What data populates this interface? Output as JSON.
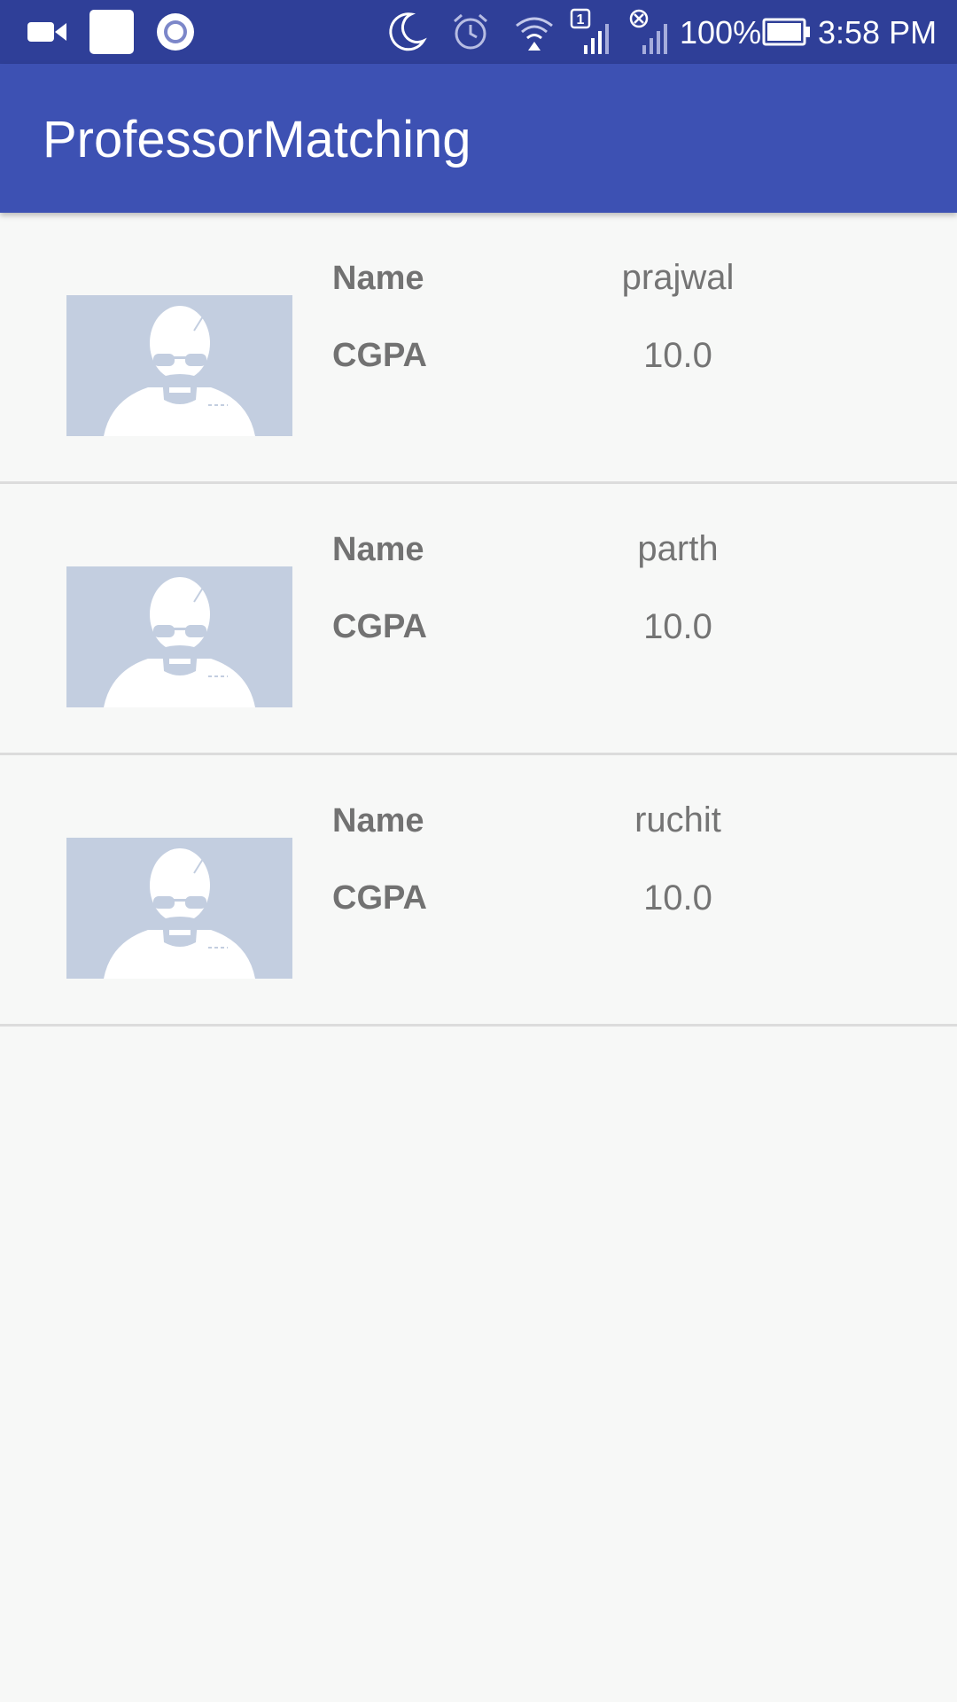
{
  "status_bar": {
    "battery_text": "100%",
    "time": "3:58 PM",
    "icons": [
      "video-camera-icon",
      "square-icon",
      "record-icon",
      "moon-icon",
      "alarm-icon",
      "wifi-icon",
      "signal-sim1-icon",
      "signal-no-sim-icon",
      "battery-icon"
    ]
  },
  "app_bar": {
    "title": "ProfessorMatching"
  },
  "students": [
    {
      "name_label": "Name",
      "name": "prajwal",
      "cgpa_label": "CGPA",
      "cgpa": "10.0"
    },
    {
      "name_label": "Name",
      "name": "parth",
      "cgpa_label": "CGPA",
      "cgpa": "10.0"
    },
    {
      "name_label": "Name",
      "name": "ruchit",
      "cgpa_label": "CGPA",
      "cgpa": "10.0"
    }
  ],
  "colors": {
    "status_bar": "#2f3f98",
    "app_bar": "#3d51b3",
    "background": "#f7f8f7",
    "avatar_bg": "#c3cee0",
    "divider": "#dcdcdc",
    "text": "#727272"
  }
}
